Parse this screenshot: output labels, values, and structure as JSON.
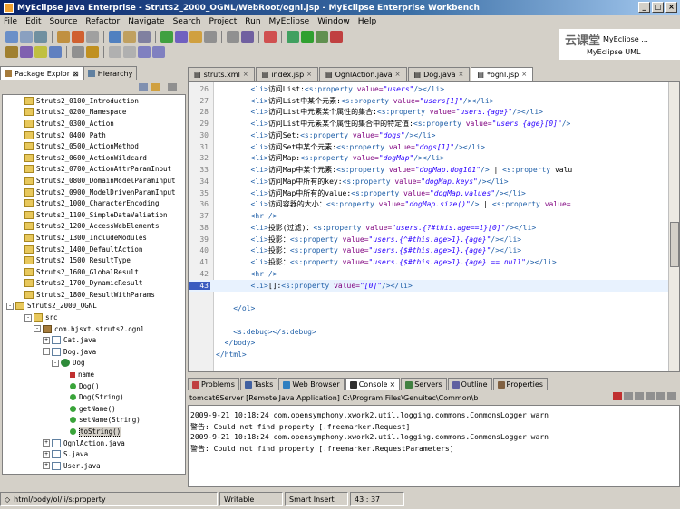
{
  "window": {
    "title": "MyEclipse Java Enterprise - Struts2_2000_OGNL/WebRoot/ognl.jsp - MyEclipse Enterprise Workbench"
  },
  "menu": [
    "File",
    "Edit",
    "Source",
    "Refactor",
    "Navigate",
    "Search",
    "Project",
    "Run",
    "MyEclipse",
    "Window",
    "Help"
  ],
  "brand": {
    "logo": "云课堂",
    "perspective_1": "MyEclipse ...",
    "perspective_2": "MyEclipse UML"
  },
  "left_panel": {
    "tabs": [
      "Package Explor",
      "Hierarchy"
    ],
    "tree": [
      {
        "label": "Struts2_0100_Introduction",
        "indent": 1,
        "icon": "folder"
      },
      {
        "label": "Struts2_0200_Namespace",
        "indent": 1,
        "icon": "folder"
      },
      {
        "label": "Struts2_0300_Action",
        "indent": 1,
        "icon": "folder"
      },
      {
        "label": "Struts2_0400_Path",
        "indent": 1,
        "icon": "folder"
      },
      {
        "label": "Struts2_0500_ActionMethod",
        "indent": 1,
        "icon": "folder"
      },
      {
        "label": "Struts2_0600_ActionWildcard",
        "indent": 1,
        "icon": "folder"
      },
      {
        "label": "Struts2_0700_ActionAttrParamInput",
        "indent": 1,
        "icon": "folder"
      },
      {
        "label": "Struts2_0800_DomainModelParamInput",
        "indent": 1,
        "icon": "folder"
      },
      {
        "label": "Struts2_0900_ModelDrivenParamInput",
        "indent": 1,
        "icon": "folder"
      },
      {
        "label": "Struts2_1000_CharacterEncoding",
        "indent": 1,
        "icon": "folder"
      },
      {
        "label": "Struts2_1100_SimpleDataValiation",
        "indent": 1,
        "icon": "folder"
      },
      {
        "label": "Struts2_1200_AccessWebElements",
        "indent": 1,
        "icon": "folder"
      },
      {
        "label": "Struts2_1300_IncludeModules",
        "indent": 1,
        "icon": "folder"
      },
      {
        "label": "Struts2_1400_DefaultAction",
        "indent": 1,
        "icon": "folder"
      },
      {
        "label": "Struts2_1500_ResultType",
        "indent": 1,
        "icon": "folder"
      },
      {
        "label": "Struts2_1600_GlobalResult",
        "indent": 1,
        "icon": "folder"
      },
      {
        "label": "Struts2_1700_DynamicResult",
        "indent": 1,
        "icon": "folder"
      },
      {
        "label": "Struts2_1800_ResultWithParams",
        "indent": 1,
        "icon": "folder"
      },
      {
        "label": "Struts2_2000_OGNL",
        "indent": 0,
        "icon": "folder",
        "twist": "-"
      },
      {
        "label": "src",
        "indent": 2,
        "icon": "folder",
        "twist": "-"
      },
      {
        "label": "com.bjsxt.struts2.ognl",
        "indent": 3,
        "icon": "pkg",
        "twist": "-"
      },
      {
        "label": "Cat.java",
        "indent": 4,
        "icon": "jfile",
        "twist": "+"
      },
      {
        "label": "Dog.java",
        "indent": 4,
        "icon": "jfile",
        "twist": "-"
      },
      {
        "label": "Dog",
        "indent": 5,
        "icon": "class",
        "twist": "-"
      },
      {
        "label": "name",
        "indent": 6,
        "icon": "field"
      },
      {
        "label": "Dog()",
        "indent": 6,
        "icon": "method"
      },
      {
        "label": "Dog(String)",
        "indent": 6,
        "icon": "method"
      },
      {
        "label": "getName()",
        "indent": 6,
        "icon": "method"
      },
      {
        "label": "setName(String)",
        "indent": 6,
        "icon": "method"
      },
      {
        "label": "toString()",
        "indent": 6,
        "icon": "method",
        "selected": true
      },
      {
        "label": "OgnlAction.java",
        "indent": 4,
        "icon": "jfile",
        "twist": "+"
      },
      {
        "label": "S.java",
        "indent": 4,
        "icon": "jfile",
        "twist": "+"
      },
      {
        "label": "User.java",
        "indent": 4,
        "icon": "jfile",
        "twist": "+"
      }
    ]
  },
  "editor": {
    "tabs": [
      {
        "label": "struts.xml",
        "active": false
      },
      {
        "label": "index.jsp",
        "active": false
      },
      {
        "label": "OgnlAction.java",
        "active": false
      },
      {
        "label": "Dog.java",
        "active": false
      },
      {
        "label": "*ognl.jsp",
        "active": true
      }
    ],
    "lines": [
      {
        "n": "26",
        "text": "        <li>访问List:<s:property value=\"users\"/></li>"
      },
      {
        "n": "27",
        "text": "        <li>访问List中某个元素:<s:property value=\"users[1]\"/></li>"
      },
      {
        "n": "28",
        "text": "        <li>访问List中元素某个属性的集合:<s:property value=\"users.{age}\"/></li>"
      },
      {
        "n": "29",
        "text": "        <li>访问List中元素某个属性的集合中的特定值:<s:property value=\"users.{age}[0]\"/>"
      },
      {
        "n": "30",
        "text": "        <li>访问Set:<s:property value=\"dogs\"/></li>"
      },
      {
        "n": "31",
        "text": "        <li>访问Set中某个元素:<s:property value=\"dogs[1]\"/></li>"
      },
      {
        "n": "32",
        "text": "        <li>访问Map:<s:property value=\"dogMap\"/></li>"
      },
      {
        "n": "33",
        "text": "        <li>访问Map中某个元素:<s:property value=\"dogMap.dog101\"/> | <s:property valu"
      },
      {
        "n": "34",
        "text": "        <li>访问Map中所有的key:<s:property value=\"dogMap.keys\"/></li>"
      },
      {
        "n": "35",
        "text": "        <li>访问Map中所有的value:<s:property value=\"dogMap.values\"/></li>"
      },
      {
        "n": "36",
        "text": "        <li>访问容器的大小：<s:property value=\"dogMap.size()\"/> | <s:property value="
      },
      {
        "n": "37",
        "text": "        <hr />"
      },
      {
        "n": "38",
        "text": "        <li>投影(过滤)：<s:property value=\"users.{?#this.age==1}[0]\"/></li>"
      },
      {
        "n": "39",
        "text": "        <li>投影：<s:property value=\"users.{^#this.age>1}.{age}\"/></li>"
      },
      {
        "n": "40",
        "text": "        <li>投影：<s:property value=\"users.{$#this.age>1}.{age}\"/></li>"
      },
      {
        "n": "41",
        "text": "        <li>投影：<s:property value=\"users.{$#this.age>1}.{age} == null\"/></li>"
      },
      {
        "n": "42",
        "text": "        <hr />"
      },
      {
        "n": "43",
        "text": "        <li>[]:<s:property value=\"[0]\"/></li>",
        "current": true
      },
      {
        "n": "",
        "text": ""
      },
      {
        "n": "",
        "text": "    </ol>"
      },
      {
        "n": "",
        "text": ""
      },
      {
        "n": "",
        "text": "    <s:debug></s:debug>"
      },
      {
        "n": "",
        "text": "  </body>"
      },
      {
        "n": "",
        "text": "</html>"
      }
    ]
  },
  "bottom_panel": {
    "tabs": [
      {
        "label": "Problems",
        "color": "#c04040"
      },
      {
        "label": "Tasks",
        "color": "#4060a0"
      },
      {
        "label": "Web Browser",
        "color": "#3080c0"
      },
      {
        "label": "Console",
        "color": "#303030",
        "active": true
      },
      {
        "label": "Servers",
        "color": "#408040"
      },
      {
        "label": "Outline",
        "color": "#6060a0"
      },
      {
        "label": "Properties",
        "color": "#806040"
      }
    ],
    "console_title": "tomcat6Server [Remote Java Application] C:\\Program Files\\Genuitec\\Common\\b",
    "console_lines": [
      "2009-9-21 10:18:24 com.opensymphony.xwork2.util.logging.commons.CommonsLogger warn",
      "警告: Could not find property [.freemarker.Request]",
      "2009-9-21 10:18:24 com.opensymphony.xwork2.util.logging.commons.CommonsLogger warn",
      "警告: Could not find property [.freemarker.RequestParameters]"
    ]
  },
  "status": {
    "path": "html/body/ol/li/s:property",
    "writable": "Writable",
    "insert_mode": "Smart Insert",
    "position": "43 : 37"
  }
}
